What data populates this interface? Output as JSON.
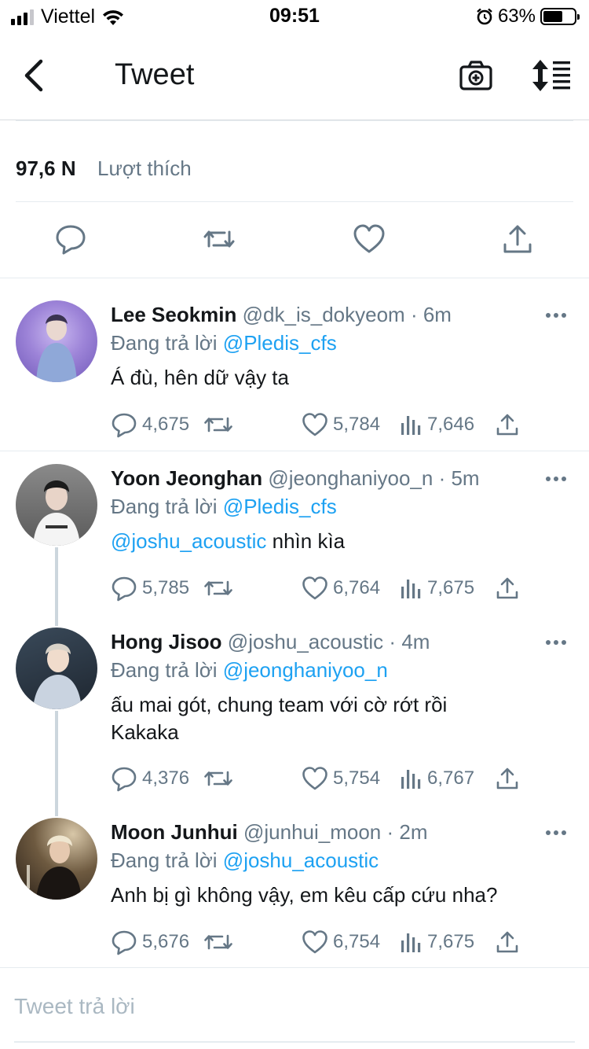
{
  "status_bar": {
    "carrier": "Viettel",
    "time": "09:51",
    "battery_percent": "63%",
    "battery_level": 0.63,
    "signal_bars": 3,
    "signal_bars_total": 4,
    "icons": [
      "wifi-icon",
      "alarm-icon",
      "battery-icon"
    ]
  },
  "nav": {
    "title": "Tweet",
    "icons": [
      "back-chevron-icon",
      "camera-plus-icon",
      "sort-icon"
    ]
  },
  "tweet": {
    "likes_count": "97,6 N",
    "likes_label": "Lượt thích",
    "actions": [
      "reply-icon",
      "retweet-icon",
      "like-icon",
      "share-icon"
    ]
  },
  "colors": {
    "link": "#1da1f2",
    "secondary_text": "#657786",
    "primary_text": "#14171a",
    "thread_line": "#ccd6dd"
  },
  "replies": [
    {
      "name": "Lee Seokmin",
      "handle": "@dk_is_dokyeom",
      "dot": "·",
      "time": "6m",
      "replying_prefix": "Đang trả lời",
      "replying_to": "@Pledis_cfs",
      "text": "Á đù, hên dữ vậy ta",
      "mention": "",
      "replies": "4,675",
      "likes": "5,784",
      "views": "7,646"
    },
    {
      "name": "Yoon Jeonghan",
      "handle": "@jeonghaniyoo_n",
      "dot": "·",
      "time": "5m",
      "replying_prefix": "Đang trả lời",
      "replying_to": "@Pledis_cfs",
      "mention": "@joshu_acoustic",
      "text": " nhìn kìa",
      "replies": "5,785",
      "likes": "6,764",
      "views": "7,675"
    },
    {
      "name": "Hong Jisoo",
      "handle": "@joshu_acoustic",
      "dot": "·",
      "time": "4m",
      "replying_prefix": "Đang trả lời",
      "replying_to": "@jeonghaniyoo_n",
      "mention": "",
      "text": "ấu mai gót, chung team với cờ rớt rồi Kakaka",
      "replies": "4,376",
      "likes": "5,754",
      "views": "6,767"
    },
    {
      "name": "Moon Junhui",
      "handle": "@junhui_moon",
      "dot": "·",
      "time": "2m",
      "replying_prefix": "Đang trả lời",
      "replying_to": "@joshu_acoustic",
      "mention": "",
      "text": "Anh bị gì không vậy, em kêu cấp cứu nha?",
      "replies": "5,676",
      "likes": "6,754",
      "views": "7,675"
    }
  ],
  "composer": {
    "placeholder": "Tweet trả lời"
  }
}
